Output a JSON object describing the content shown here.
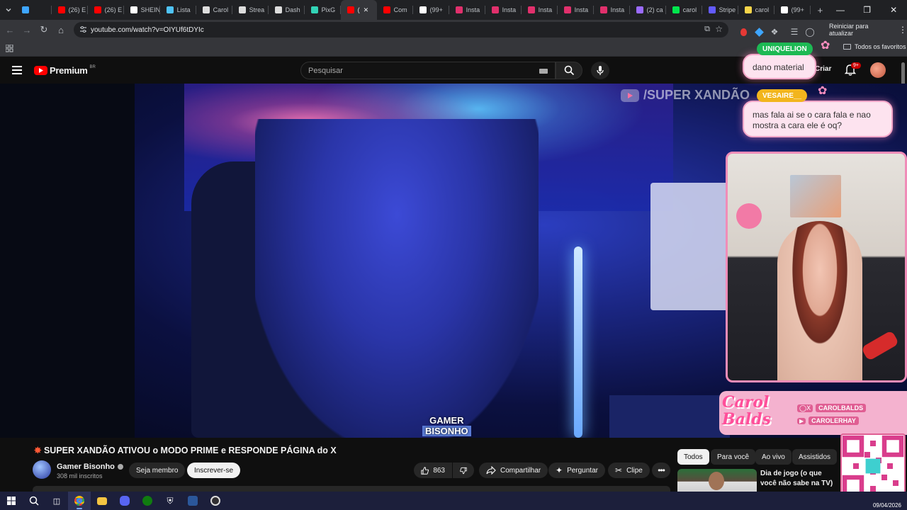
{
  "browser": {
    "tabs": [
      {
        "label": "",
        "color": "#3ea6ff"
      },
      {
        "label": "(26) E",
        "color": "#ff0000"
      },
      {
        "label": "(26) E",
        "color": "#ff0000"
      },
      {
        "label": "SHEIN",
        "color": "#ffffff"
      },
      {
        "label": "Lista",
        "color": "#4fc3f7"
      },
      {
        "label": "Carol",
        "color": "#dddddd"
      },
      {
        "label": "Strea",
        "color": "#dddddd"
      },
      {
        "label": "Dash",
        "color": "#dddddd"
      },
      {
        "label": "PixG",
        "color": "#32d3b6"
      },
      {
        "label": "(",
        "color": "#ff0000",
        "active": true
      },
      {
        "label": "Com",
        "color": "#ff0000"
      },
      {
        "label": "(99+",
        "color": "#ffffff"
      },
      {
        "label": "Insta",
        "color": "#e1306c"
      },
      {
        "label": "Insta",
        "color": "#e1306c"
      },
      {
        "label": "Insta",
        "color": "#e1306c"
      },
      {
        "label": "Insta",
        "color": "#e1306c"
      },
      {
        "label": "Insta",
        "color": "#e1306c"
      },
      {
        "label": "(2) ca",
        "color": "#9b6bff"
      },
      {
        "label": "carol",
        "color": "#00e64d"
      },
      {
        "label": "Stripe",
        "color": "#635bff"
      },
      {
        "label": "carol",
        "color": "#f7d54a"
      },
      {
        "label": "(99+",
        "color": "#ffffff"
      }
    ],
    "url": "youtube.com/watch?v=OIYUf6tDYIc",
    "restart_label": "Reiniciar para atualizar",
    "bookmarks_label": "Todos os favoritos"
  },
  "youtube": {
    "logo_text": "Premium",
    "logo_badge": "BR",
    "search_placeholder": "Pesquisar",
    "create_label": "Criar",
    "notification_count": "9+"
  },
  "video": {
    "watermark": "/SUPER XANDÃO",
    "badge_line1": "GAMER",
    "badge_line2": "BISONHO",
    "title": "SUPER XANDÃO ATIVOU o MODO PRIME e RESPONDE PÁGINA do X",
    "channel_name": "Gamer Bisonho",
    "subscribers": "308 mil inscritos",
    "join_label": "Seja membro",
    "subscribe_label": "Inscrever-se",
    "likes": "863",
    "share_label": "Compartilhar",
    "ask_label": "Perguntar",
    "clip_label": "Clipe"
  },
  "overlay": {
    "chat": [
      {
        "user": "UNIQUELION",
        "message": "dano material",
        "user_color": "#1db954"
      },
      {
        "user": "VESAIRE__",
        "message": "mas fala ai se o cara fala e nao mostra a cara ele é oq?",
        "user_color": "#f2b51d"
      }
    ],
    "brand_logo": "Carol Balds",
    "handle_x": "CAROLBALDS",
    "handle_yt": "CAROLERHAY"
  },
  "recommendations": {
    "chips": [
      "Todos",
      "Para você",
      "Ao vivo",
      "Assistidos"
    ],
    "first_title": "Dia de jogo (o que você não sabe na TV)"
  },
  "taskbar": {
    "date": "09/04/2026"
  }
}
